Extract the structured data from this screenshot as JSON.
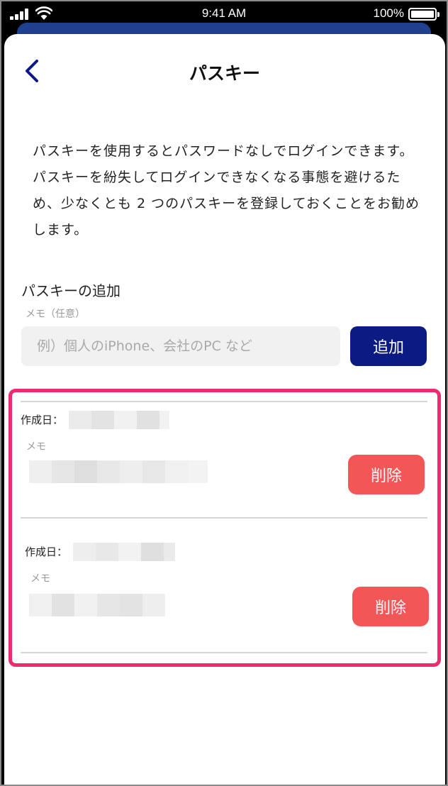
{
  "status_bar": {
    "time": "9:41 AM",
    "battery": "100%",
    "battery_level": 1.0
  },
  "header": {
    "back_icon": "chevron-left-icon",
    "title": "パスキー"
  },
  "description": "パスキーを使用するとパスワードなしでログインできます。パスキーを紛失してログインできなくなる事態を避けるため、少なくとも 2 つのパスキーを登録しておくことをお勧めします。",
  "add_section": {
    "title": "パスキーの追加",
    "memo_label": "メモ（任意）",
    "placeholder": "例）個人のiPhone、会社のPC など",
    "value": "",
    "add_label": "追加"
  },
  "passkeys": [
    {
      "created_label": "作成日：",
      "memo_label": "メモ",
      "delete_label": "削除"
    },
    {
      "created_label": "作成日：",
      "memo_label": "メモ",
      "delete_label": "削除"
    }
  ],
  "colors": {
    "title_blue": "#0c1a83",
    "highlight": "#ee2b70",
    "delete_red": "#f25656",
    "app_blue": "#1f3f8f"
  }
}
